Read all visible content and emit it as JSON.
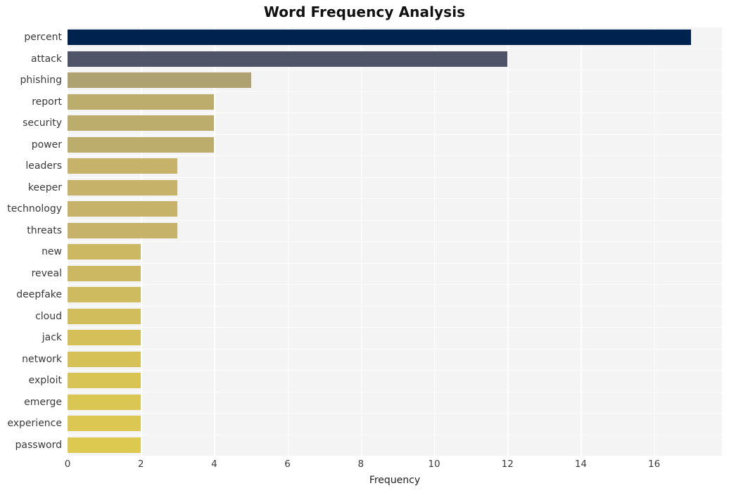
{
  "chart_data": {
    "type": "bar",
    "orientation": "horizontal",
    "title": "Word Frequency Analysis",
    "xlabel": "Frequency",
    "ylabel": "",
    "xlim": [
      0,
      17.85
    ],
    "xticks": [
      0,
      2,
      4,
      6,
      8,
      10,
      12,
      14,
      16
    ],
    "grid": true,
    "legend": null,
    "categories": [
      "percent",
      "attack",
      "phishing",
      "report",
      "security",
      "power",
      "leaders",
      "keeper",
      "technology",
      "threats",
      "new",
      "reveal",
      "deepfake",
      "cloud",
      "jack",
      "network",
      "exploit",
      "emerge",
      "experience",
      "password"
    ],
    "values": [
      17,
      12,
      5,
      4,
      4,
      4,
      3,
      3,
      3,
      3,
      2,
      2,
      2,
      2,
      2,
      2,
      2,
      2,
      2,
      2
    ],
    "bar_colors": [
      "#00224e",
      "#4f5468",
      "#aea273",
      "#bdad6d",
      "#bdad6d",
      "#bdad6d",
      "#c6b369",
      "#c6b369",
      "#c6b369",
      "#c6b369",
      "#ccb862",
      "#ccb862",
      "#cfbb5f",
      "#d2bd5c",
      "#d4bf59",
      "#d6c157",
      "#d8c455",
      "#dac653",
      "#dbc751",
      "#ddc94f"
    ],
    "plot_background": "#f4f4f4",
    "grid_color": "#ffffff",
    "figure_background": "#ffffff",
    "title_color": "#111111",
    "tick_label_color": "#3a3a3a"
  }
}
